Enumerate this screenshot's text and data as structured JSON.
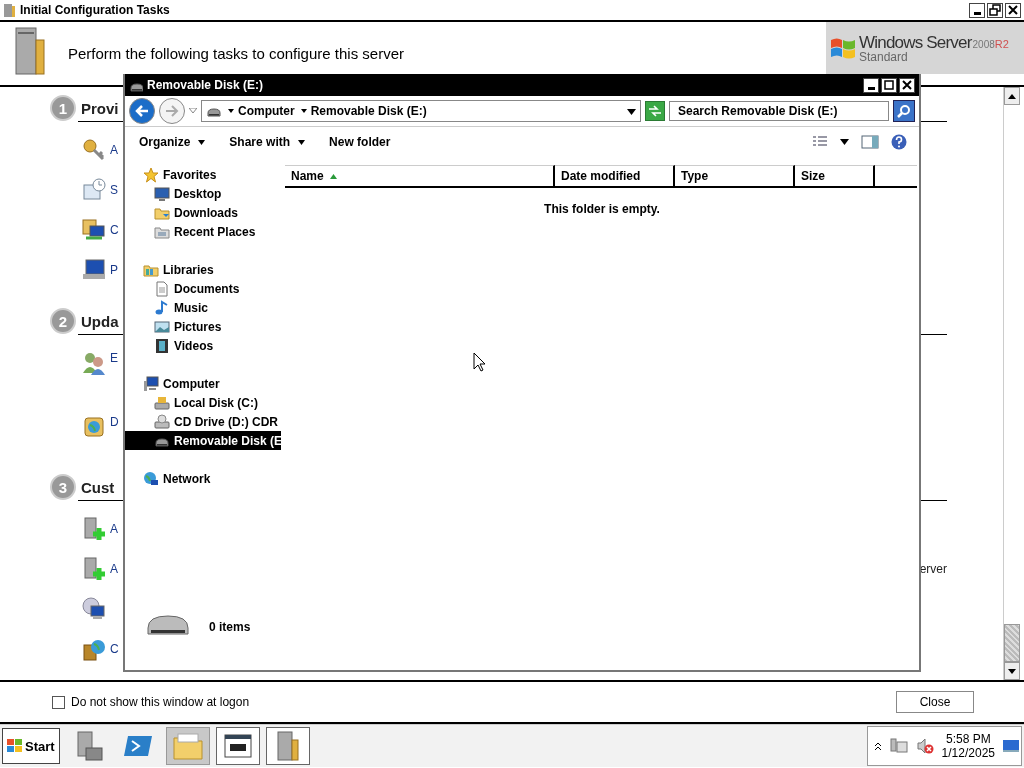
{
  "window": {
    "title": "Initial Configuration Tasks"
  },
  "header": {
    "text": "Perform the following tasks to configure this server",
    "logo": {
      "brand": "Windows Server",
      "version": "2008",
      "tag": "R2",
      "edition": "Standard"
    }
  },
  "sections": [
    {
      "number": "1",
      "title": "Provi",
      "tasks": [
        {
          "kind": "link",
          "label": "A"
        },
        {
          "kind": "link",
          "label": "S"
        },
        {
          "kind": "link",
          "label": "C"
        },
        {
          "kind": "link",
          "label": "P"
        }
      ]
    },
    {
      "number": "2",
      "title": "Upda",
      "tasks": [
        {
          "kind": "link",
          "label": "E"
        },
        {
          "kind": "link",
          "label": "D"
        }
      ]
    },
    {
      "number": "3",
      "title": "Cust",
      "tasks": [
        {
          "kind": "link",
          "label": "A"
        },
        {
          "kind": "link",
          "label": "A",
          "label_end": "erver"
        },
        {
          "kind": "icon"
        },
        {
          "kind": "link",
          "label": "C"
        }
      ]
    }
  ],
  "footer": {
    "checkbox": {
      "label": "Do not show this window at logon",
      "checked": false
    },
    "close_button": "Close"
  },
  "explorer": {
    "title": "Removable Disk (E:)",
    "breadcrumb": [
      "Computer",
      "Removable Disk (E:)"
    ],
    "search": {
      "placeholder": "Search Removable Disk (E:)"
    },
    "toolbar": [
      {
        "label": "Organize",
        "dropdown": true
      },
      {
        "label": "Share with",
        "dropdown": true
      },
      {
        "label": "New folder",
        "dropdown": false
      }
    ],
    "nav": [
      {
        "label": "Favorites",
        "selected": false,
        "children": [
          {
            "label": "Desktop",
            "selected": false
          },
          {
            "label": "Downloads",
            "selected": false
          },
          {
            "label": "Recent Places",
            "selected": false
          }
        ]
      },
      {
        "label": "Libraries",
        "selected": false,
        "children": [
          {
            "label": "Documents",
            "selected": false
          },
          {
            "label": "Music",
            "selected": false
          },
          {
            "label": "Pictures",
            "selected": false
          },
          {
            "label": "Videos",
            "selected": false
          }
        ]
      },
      {
        "label": "Computer",
        "selected": false,
        "children": [
          {
            "label": "Local Disk (C:)",
            "selected": false
          },
          {
            "label": "CD Drive (D:) CDR",
            "selected": false
          },
          {
            "label": "Removable Disk (E",
            "selected": true
          }
        ]
      },
      {
        "label": "Network",
        "selected": false
      }
    ],
    "columns": [
      {
        "label": "Name",
        "sorted": true
      },
      {
        "label": "Date modified",
        "sorted": false
      },
      {
        "label": "Type",
        "sorted": false
      },
      {
        "label": "Size",
        "sorted": false
      }
    ],
    "empty_message": "This folder is empty.",
    "details": {
      "count": "0 items"
    }
  },
  "taskbar": {
    "start": "Start",
    "apps": [
      {
        "kind": "launcher",
        "selected": false
      },
      {
        "kind": "launcher",
        "selected": false
      },
      {
        "kind": "window",
        "selected": true
      },
      {
        "kind": "window",
        "selected": false
      },
      {
        "kind": "window",
        "selected": false
      }
    ],
    "clock": {
      "time": "5:58 PM",
      "date": "1/12/2025"
    }
  }
}
